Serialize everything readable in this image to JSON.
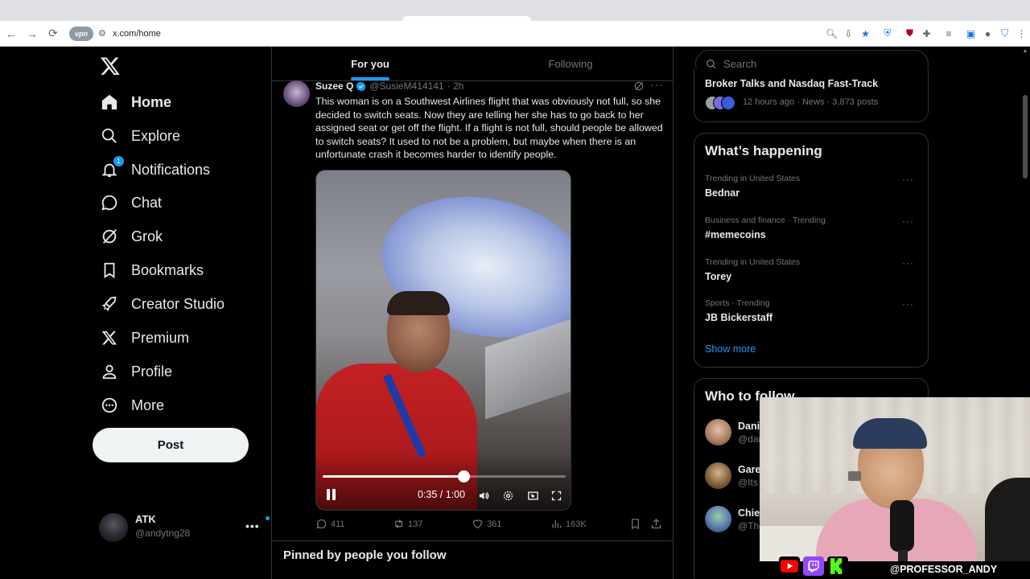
{
  "browser": {
    "url": "x.com/home",
    "vpn_label": "vpn",
    "extensions": [
      "zoom-icon",
      "install-icon",
      "bookmark-star-icon",
      "shield-icon",
      "ublock-icon",
      "puzzle-icon",
      "playlist-icon",
      "sidepanel-icon",
      "profile-icon",
      "security-icon",
      "menu-icon"
    ]
  },
  "nav": {
    "items": [
      {
        "label": "Home",
        "icon": "home-icon",
        "active": true
      },
      {
        "label": "Explore",
        "icon": "search-icon"
      },
      {
        "label": "Notifications",
        "icon": "bell-icon",
        "badge": "1"
      },
      {
        "label": "Chat",
        "icon": "chat-icon"
      },
      {
        "label": "Grok",
        "icon": "grok-icon"
      },
      {
        "label": "Bookmarks",
        "icon": "bookmark-icon"
      },
      {
        "label": "Creator Studio",
        "icon": "rocket-icon"
      },
      {
        "label": "Premium",
        "icon": "x-logo-icon"
      },
      {
        "label": "Profile",
        "icon": "person-icon"
      },
      {
        "label": "More",
        "icon": "more-circle-icon"
      }
    ],
    "post_label": "Post"
  },
  "account": {
    "name": "ATK",
    "handle": "@andytng28"
  },
  "timeline": {
    "tabs": [
      "For you",
      "Following"
    ],
    "active_tab": "For you",
    "tweet": {
      "name": "Suzee Q",
      "handle": "@SusieM414141",
      "age": "· 2h",
      "text": "This woman is on a Southwest Airlines flight that was obviously not full, so she decided to switch seats. Now they are telling her she has to go back to her assigned seat or get off the flight. If a flight is not full, should people be allowed to switch seats? It used to not be a problem, but maybe when there is an unfortunate crash it becomes harder to identify people.",
      "video": {
        "timecode": "0:35 / 1:00",
        "progress": 0.58
      },
      "stats": {
        "replies": "411",
        "reposts": "137",
        "likes": "361",
        "views": "163K"
      }
    },
    "next_section": "Pinned by people you follow"
  },
  "sidebar": {
    "search_placeholder": "Search",
    "news": {
      "title": "Broker Talks and Nasdaq Fast-Track",
      "meta": "12 hours ago · News · 3,873 posts"
    },
    "happening": {
      "heading": "What’s happening",
      "trends": [
        {
          "context": "Trending in United States",
          "title": "Bednar"
        },
        {
          "context": "Business and finance · Trending",
          "title": "#memecoins"
        },
        {
          "context": "Trending in United States",
          "title": "Torey"
        },
        {
          "context": "Sports · Trending",
          "title": "JB Bickerstaff"
        }
      ],
      "show_more": "Show more"
    },
    "who_to_follow": {
      "heading": "Who to follow",
      "accounts": [
        {
          "name": "Dani",
          "handle": "@dar"
        },
        {
          "name": "Gare",
          "handle": "@Its"
        },
        {
          "name": "Chie",
          "handle": "@The"
        }
      ]
    }
  },
  "stream_overlay": {
    "handle": "@PROFESSOR_ANDY",
    "socials": [
      "youtube-icon",
      "twitch-icon",
      "kick-icon"
    ]
  },
  "colors": {
    "accent": "#1d9bf0",
    "background": "#000000",
    "text": "#e7e9ea",
    "muted": "#71767b",
    "border": "#2f3336"
  }
}
